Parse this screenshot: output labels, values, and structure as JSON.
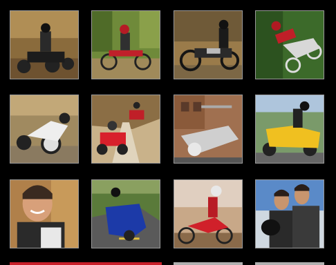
{
  "gallery": {
    "tiles": [
      {
        "subject": "atv-rider-dirt"
      },
      {
        "subject": "motocross-rider-forest"
      },
      {
        "subject": "cruiser-motorcycle-rider"
      },
      {
        "subject": "motocross-jump"
      },
      {
        "subject": "sport-bike-leaning"
      },
      {
        "subject": "atv-riders-trail"
      },
      {
        "subject": "chrome-cruiser-closeup"
      },
      {
        "subject": "yellow-touring-bike"
      },
      {
        "subject": "smiling-rider-portrait"
      },
      {
        "subject": "blue-touring-bike-road"
      },
      {
        "subject": "dirt-bike-rider-red"
      },
      {
        "subject": "two-riders-portrait"
      }
    ],
    "accent_color": "#c8202a",
    "border_color": "#9a9a9a",
    "background_color": "#000000"
  }
}
